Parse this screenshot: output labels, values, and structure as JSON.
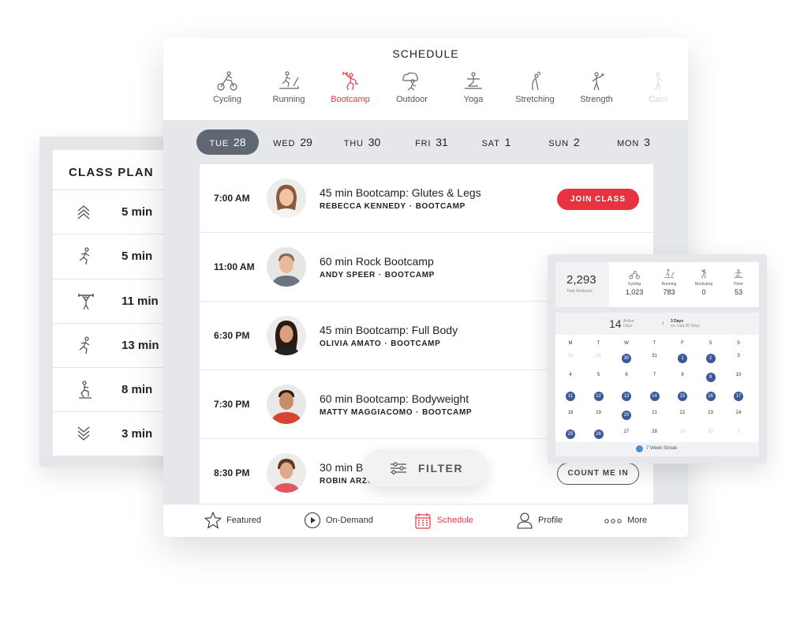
{
  "class_plan": {
    "title": "CLASS PLAN",
    "items": [
      {
        "icon": "chevrons-up-icon",
        "duration": "5 min"
      },
      {
        "icon": "running-icon",
        "duration": "5 min"
      },
      {
        "icon": "weightlifting-icon",
        "duration": "11 min"
      },
      {
        "icon": "running-icon",
        "duration": "13 min"
      },
      {
        "icon": "floor-exercise-icon",
        "duration": "8 min"
      },
      {
        "icon": "chevrons-down-icon",
        "duration": "3 min"
      }
    ]
  },
  "schedule": {
    "title": "SCHEDULE",
    "categories": [
      {
        "label": "Cycling",
        "icon": "cycling-icon"
      },
      {
        "label": "Running",
        "icon": "treadmill-icon"
      },
      {
        "label": "Bootcamp",
        "icon": "bootcamp-icon"
      },
      {
        "label": "Outdoor",
        "icon": "outdoor-icon"
      },
      {
        "label": "Yoga",
        "icon": "yoga-icon"
      },
      {
        "label": "Stretching",
        "icon": "stretching-icon"
      },
      {
        "label": "Strength",
        "icon": "strength-icon"
      },
      {
        "label": "Card",
        "icon": "cardio-icon"
      }
    ],
    "active_category": "Bootcamp",
    "days": [
      {
        "dow": "TUE",
        "num": "28"
      },
      {
        "dow": "WED",
        "num": "29"
      },
      {
        "dow": "THU",
        "num": "30"
      },
      {
        "dow": "FRI",
        "num": "31"
      },
      {
        "dow": "SAT",
        "num": "1"
      },
      {
        "dow": "SUN",
        "num": "2"
      },
      {
        "dow": "MON",
        "num": "3"
      }
    ],
    "classes": [
      {
        "time": "7:00 AM",
        "title": "45 min Bootcamp: Glutes & Legs",
        "instructor": "REBECCA KENNEDY",
        "type": "BOOTCAMP",
        "action": "JOIN CLASS"
      },
      {
        "time": "11:00 AM",
        "title": "60 min Rock Bootcamp",
        "instructor": "ANDY SPEER",
        "type": "BOOTCAMP"
      },
      {
        "time": "6:30 PM",
        "title": "45 min Bootcamp: Full Body",
        "instructor": "OLIVIA AMATO",
        "type": "BOOTCAMP"
      },
      {
        "time": "7:30 PM",
        "title": "60 min Bootcamp: Bodyweight",
        "instructor": "MATTY MAGGIACOMO",
        "type": "BOOTCAMP"
      },
      {
        "time": "8:30 PM",
        "title": "30 min B",
        "instructor": "ROBIN ARZO",
        "type": "",
        "action": "COUNT ME IN"
      }
    ],
    "sub_separator": "·",
    "filter_label": "FILTER"
  },
  "tabbar": {
    "featured": "Featured",
    "on_demand": "On-Demand",
    "schedule": "Schedule",
    "profile": "Profile",
    "more": "More"
  },
  "stats": {
    "total_workouts": "2,293",
    "total_workouts_label": "Total Workouts",
    "disciplines": [
      {
        "label": "Cycling",
        "value": "1,023",
        "icon": "cycling-icon"
      },
      {
        "label": "Running",
        "value": "783",
        "icon": "treadmill-icon"
      },
      {
        "label": "Bootcamp",
        "value": "0",
        "icon": "bootcamp-icon"
      },
      {
        "label": "Floor",
        "value": "53",
        "icon": "floor-icon"
      }
    ],
    "active_days": "14",
    "active_days_label": "Active Days",
    "trend_value": "3 Days",
    "trend_label": "vs. Last 30 Days",
    "calendar": {
      "headers": [
        "M",
        "T",
        "W",
        "T",
        "F",
        "S",
        "S"
      ],
      "weeks": [
        [
          {
            "d": "28",
            "s": "dim"
          },
          {
            "d": "29",
            "s": "dim"
          },
          {
            "d": "30",
            "s": "on"
          },
          {
            "d": "31",
            "s": ""
          },
          {
            "d": "1",
            "s": "on"
          },
          {
            "d": "2",
            "s": "on"
          },
          {
            "d": "3",
            "s": ""
          }
        ],
        [
          {
            "d": "4",
            "s": ""
          },
          {
            "d": "5",
            "s": ""
          },
          {
            "d": "6",
            "s": ""
          },
          {
            "d": "7",
            "s": ""
          },
          {
            "d": "8",
            "s": ""
          },
          {
            "d": "9",
            "s": "on"
          },
          {
            "d": "10",
            "s": ""
          }
        ],
        [
          {
            "d": "11",
            "s": "on"
          },
          {
            "d": "12",
            "s": "on"
          },
          {
            "d": "13",
            "s": "on"
          },
          {
            "d": "14",
            "s": "on"
          },
          {
            "d": "15",
            "s": "on"
          },
          {
            "d": "16",
            "s": "on"
          },
          {
            "d": "17",
            "s": "on"
          }
        ],
        [
          {
            "d": "18",
            "s": ""
          },
          {
            "d": "19",
            "s": ""
          },
          {
            "d": "20",
            "s": "on"
          },
          {
            "d": "21",
            "s": ""
          },
          {
            "d": "22",
            "s": ""
          },
          {
            "d": "23",
            "s": ""
          },
          {
            "d": "24",
            "s": ""
          }
        ],
        [
          {
            "d": "25",
            "s": "on"
          },
          {
            "d": "26",
            "s": "on"
          },
          {
            "d": "27",
            "s": ""
          },
          {
            "d": "28",
            "s": ""
          },
          {
            "d": "29",
            "s": "dim"
          },
          {
            "d": "30",
            "s": "dim"
          },
          {
            "d": "1",
            "s": "dim"
          }
        ]
      ]
    },
    "streak": "7 Week Streak"
  },
  "colors": {
    "accent": "#e53945",
    "calendar_dot": "#3b5998",
    "day_active": "#5e6772"
  }
}
